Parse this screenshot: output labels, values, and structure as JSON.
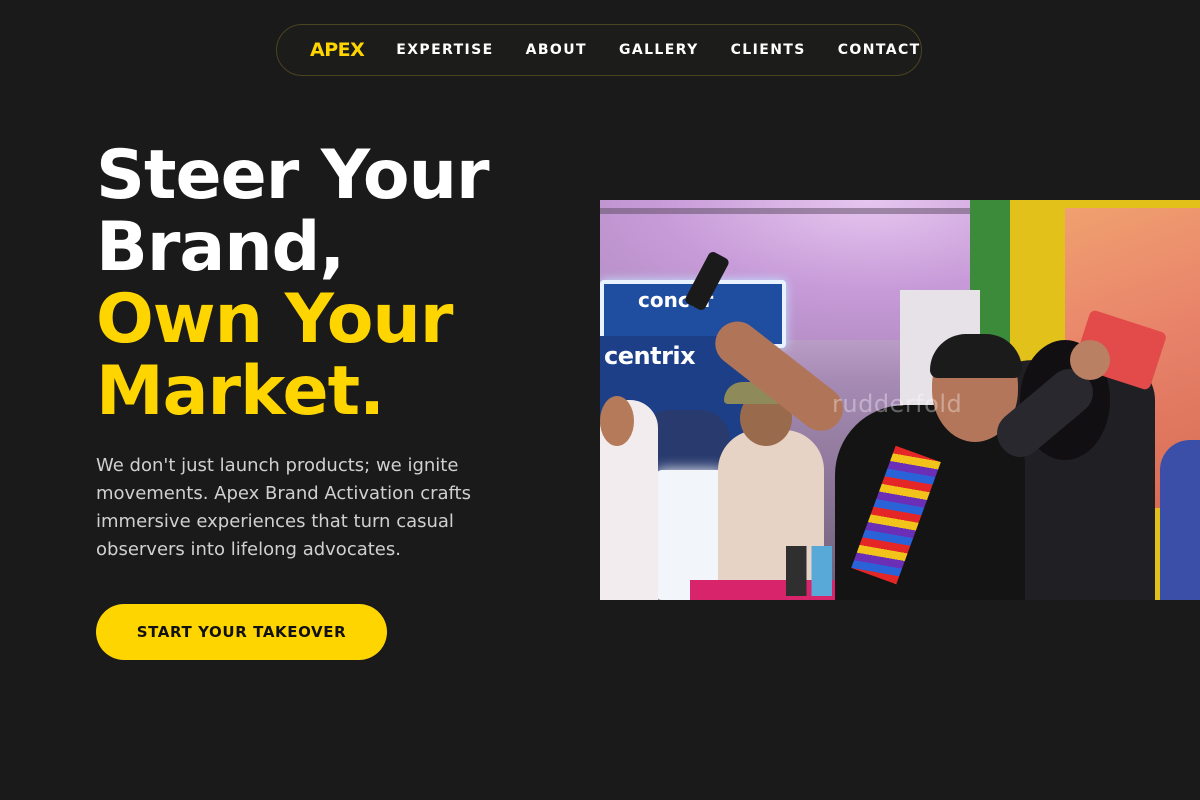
{
  "nav": {
    "logo": "APEX",
    "links": [
      "EXPERTISE",
      "ABOUT",
      "GALLERY",
      "CLIENTS",
      "CONTACT"
    ]
  },
  "hero": {
    "headline_white": [
      "Steer Your",
      "Brand,"
    ],
    "headline_accent": [
      "Own Your",
      "Market."
    ],
    "lede": "We don't just launch products; we ignite movements. Apex Brand Activation crafts immersive experiences that turn casual observers into lifelong advocates.",
    "cta_label": "START YOUR TAKEOVER"
  },
  "photo": {
    "booth_text": "centrix",
    "booth_text_top": "concor",
    "watermark": "rudderfold"
  },
  "colors": {
    "background": "#1a1a1a",
    "accent": "#ffd500",
    "text": "#ffffff",
    "muted_text": "#d0d0d0"
  }
}
